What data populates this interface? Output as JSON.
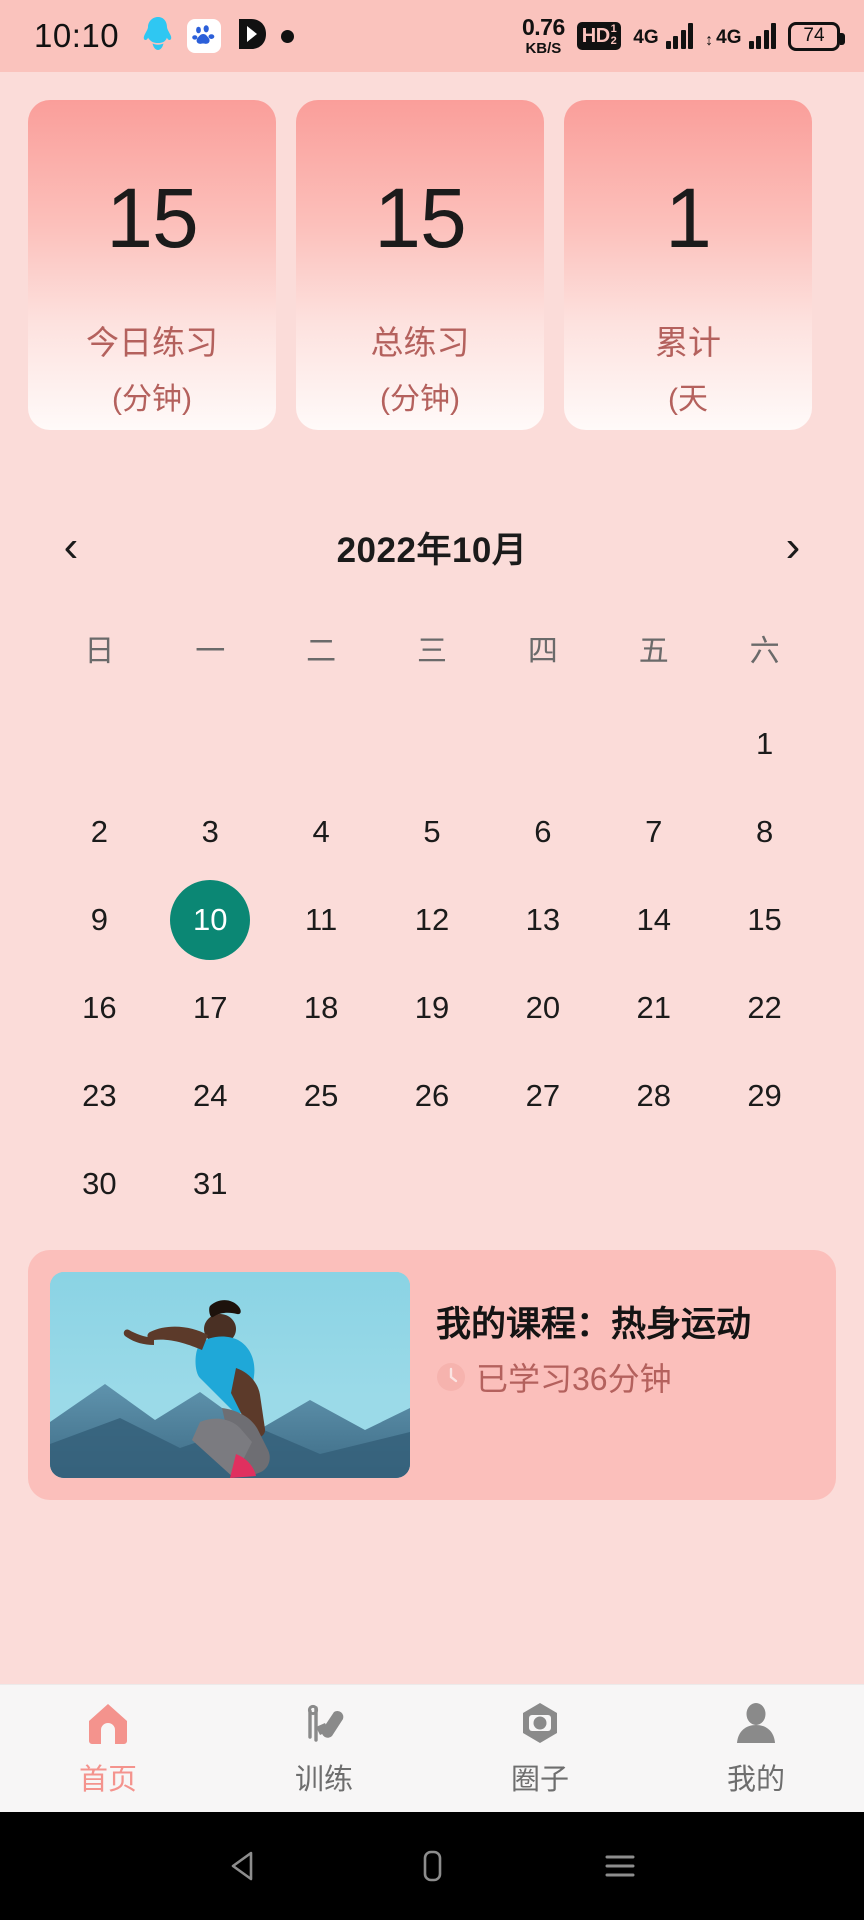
{
  "status_bar": {
    "time": "10:10",
    "left_icons": [
      "qq-icon",
      "baidu-icon",
      "kuaishou-icon",
      "dot-icon"
    ],
    "net_speed_value": "0.76",
    "net_speed_unit": "KB/S",
    "hd_badge": "HD",
    "hd_badge_sup": "1",
    "hd_badge_sub": "2",
    "sim1_network": "4G",
    "sim2_network": "4G",
    "battery_percent": "74"
  },
  "stats": {
    "cards": [
      {
        "value": "15",
        "label": "今日练习",
        "unit": "(分钟)"
      },
      {
        "value": "15",
        "label": "总练习",
        "unit": "(分钟)"
      },
      {
        "value": "1",
        "label": "累计",
        "unit": "(天"
      }
    ]
  },
  "calendar": {
    "prev_label": "‹",
    "next_label": "›",
    "title": "2022年10月",
    "weekdays": [
      "日",
      "一",
      "二",
      "三",
      "四",
      "五",
      "六"
    ],
    "leading_blanks": 6,
    "days": [
      1,
      2,
      3,
      4,
      5,
      6,
      7,
      8,
      9,
      10,
      11,
      12,
      13,
      14,
      15,
      16,
      17,
      18,
      19,
      20,
      21,
      22,
      23,
      24,
      25,
      26,
      27,
      28,
      29,
      30,
      31
    ],
    "selected_day": 10,
    "selected_color": "#0b8774"
  },
  "course": {
    "title": "我的课程：热身运动",
    "progress_text": "已学习36分钟",
    "clock_icon": "clock-icon",
    "thumbnail_alt": "runner-photo"
  },
  "tabbar": {
    "accent_color": "#f4938d",
    "items": [
      {
        "label": "首页",
        "icon": "home-icon",
        "active": true
      },
      {
        "label": "训练",
        "icon": "dumbbell-icon",
        "active": false
      },
      {
        "label": "圈子",
        "icon": "camera-icon",
        "active": false
      },
      {
        "label": "我的",
        "icon": "person-icon",
        "active": false
      }
    ]
  },
  "system_nav": {
    "back": "back-triangle-icon",
    "home": "home-rect-icon",
    "recents": "recents-lines-icon"
  }
}
